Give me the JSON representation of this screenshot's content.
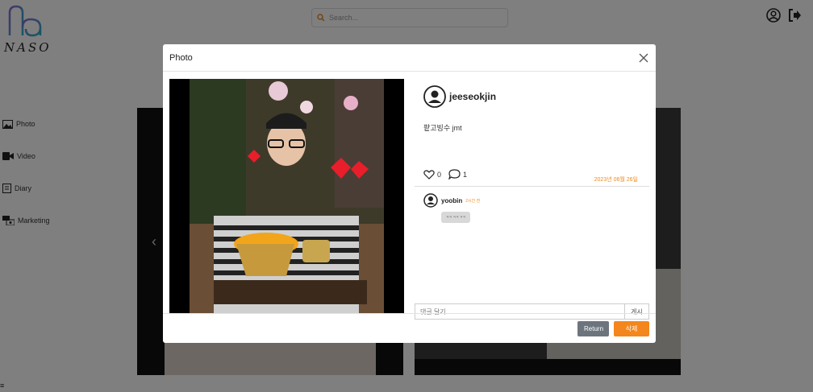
{
  "app": {
    "logo_text": "NASO"
  },
  "search": {
    "placeholder": "Search..."
  },
  "sidebar": {
    "items": [
      {
        "label": "Photo",
        "icon": "photo-icon"
      },
      {
        "label": "Video",
        "icon": "video-icon"
      },
      {
        "label": "Diary",
        "icon": "diary-icon"
      },
      {
        "label": "Marketing",
        "icon": "marketing-icon"
      }
    ]
  },
  "modal": {
    "title": "Photo",
    "author": "jeeseokjin",
    "caption": "팥고빙수 jmt",
    "likes": "0",
    "comments_count": "1",
    "date": "2023년 06월 26일",
    "comment": {
      "user": "yoobin",
      "time": "2시간 전",
      "text": "ㅋㅋ ㅋㅋ ㅋㅋ"
    },
    "comment_placeholder": "댓글 달기...",
    "post_label": "게시",
    "return_label": "Return",
    "delete_label": "삭제"
  },
  "colors": {
    "accent": "#f3861c",
    "secondary": "#6c757d"
  }
}
